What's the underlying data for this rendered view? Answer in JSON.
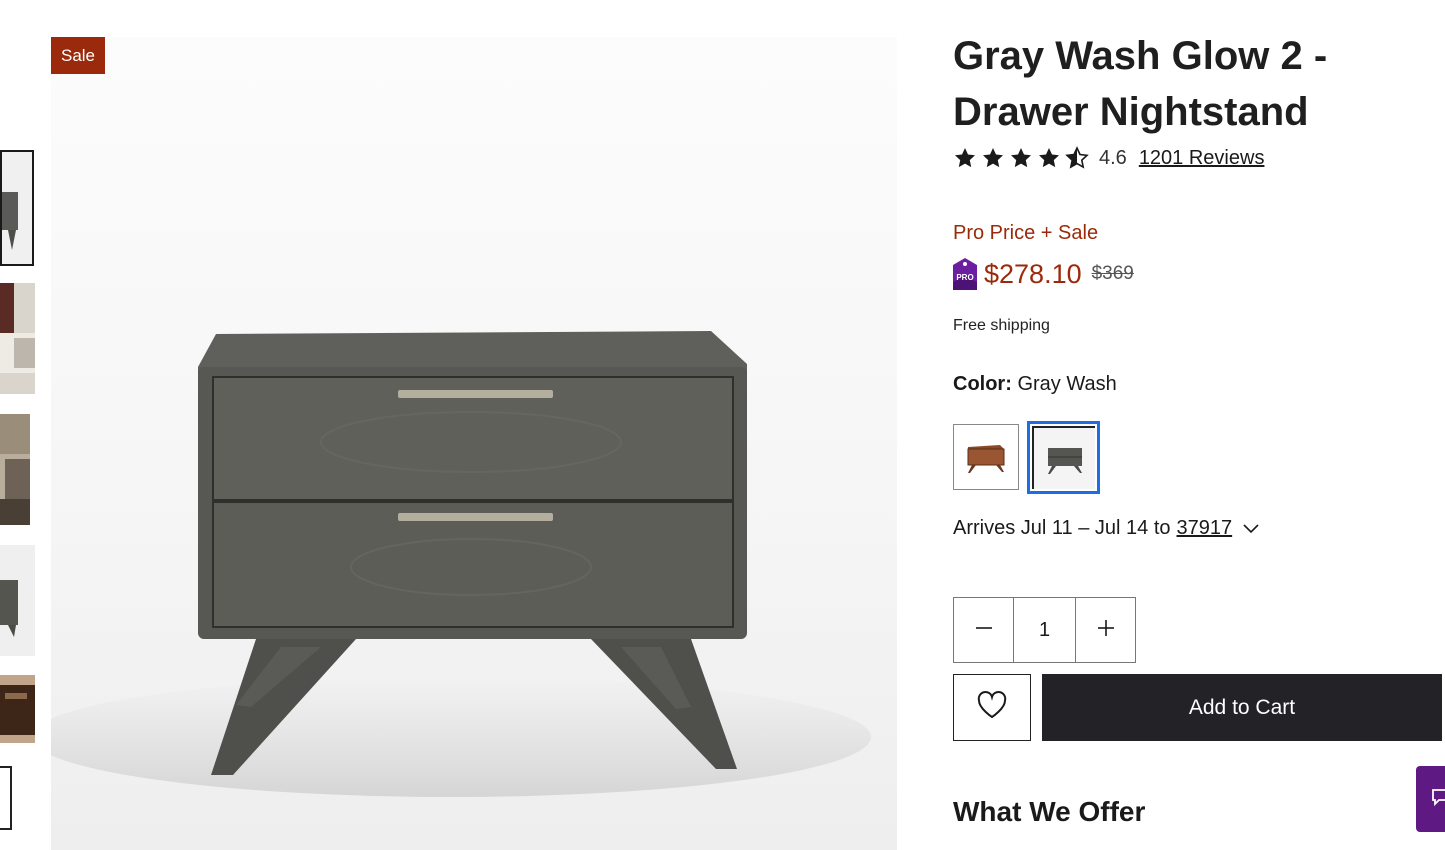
{
  "product": {
    "sale_badge": "Sale",
    "title": "Gray Wash Glow 2 - Drawer Nightstand",
    "rating": {
      "value": "4.6",
      "stars": 4.5,
      "reviews_link": "1201 Reviews"
    },
    "pricing": {
      "promo_label": "Pro Price + Sale",
      "price": "$278.10",
      "was_price": "$369",
      "badge_text": "PRO"
    },
    "shipping": "Free shipping",
    "color": {
      "label": "Color:",
      "selected": "Gray Wash",
      "swatches": [
        {
          "name": "walnut",
          "selected": false
        },
        {
          "name": "gray-wash",
          "selected": true
        }
      ]
    },
    "delivery": {
      "text": "Arrives Jul 11 – Jul 14 to",
      "zip": "37917"
    },
    "quantity": "1",
    "add_to_cart": "Add to Cart",
    "section_heading": "What We Offer"
  },
  "gallery": {
    "thumbnails": 5,
    "selected_index": 0
  },
  "icons": {
    "star": "star-icon",
    "minus": "minus-icon",
    "plus": "plus-icon",
    "heart": "heart-icon",
    "chevron": "chevron-down-icon",
    "chat": "chat-icon"
  },
  "colors": {
    "sale": "#9a2a0b",
    "cart_button": "#222227",
    "selected_swatch": "#1d6fe0",
    "chat": "#5e1a82"
  }
}
